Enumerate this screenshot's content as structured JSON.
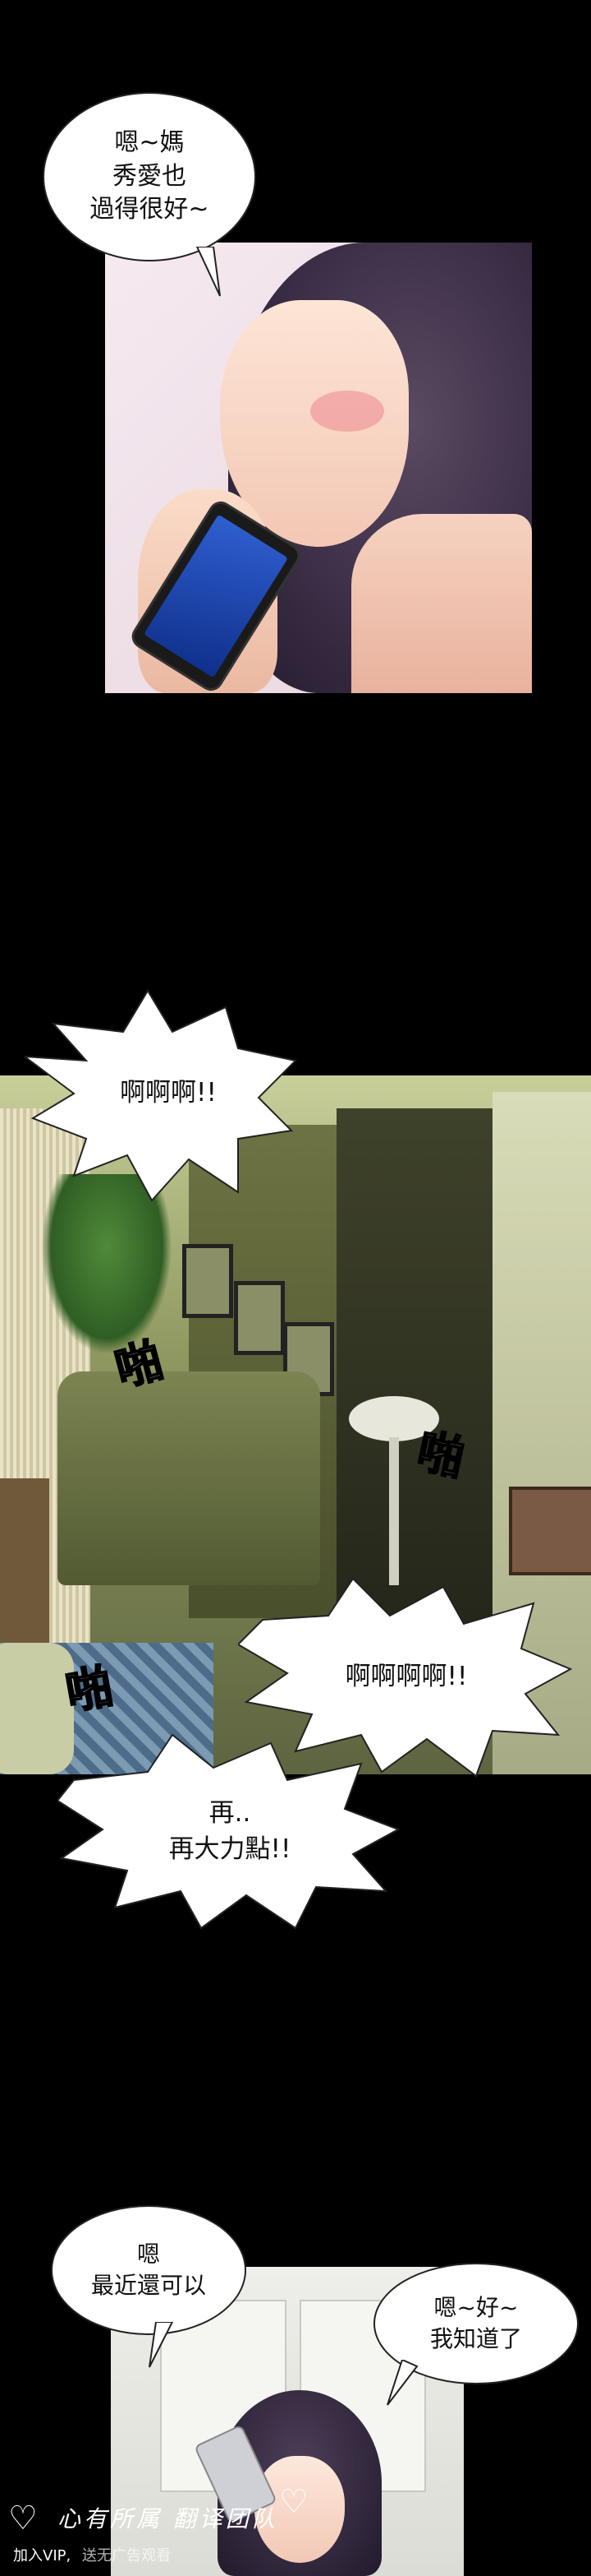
{
  "panel1": {
    "bubble": "嗯~媽\n秀愛也\n過得很好~"
  },
  "panel2": {
    "shout_top": "啊啊啊!!",
    "sfx_left_top": "啪",
    "sfx_right": "啪",
    "sfx_left_bottom": "啪",
    "shout_mid": "啊啊啊啊!!",
    "shout_bottom": "再..\n再大力點!!"
  },
  "panel3": {
    "bubble_left": "嗯\n最近還可以",
    "bubble_right": "嗯~好~\n我知道了"
  },
  "watermark": {
    "title": "心有所属 翻译团队",
    "subtitle": "加入VIP,",
    "subtitle2": "送无广告观看"
  }
}
